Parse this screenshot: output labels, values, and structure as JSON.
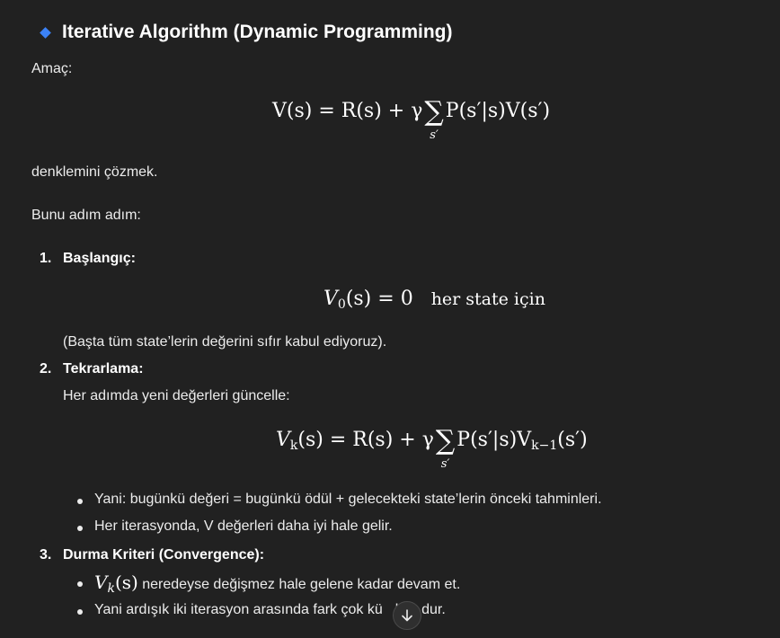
{
  "heading": {
    "icon": "blue-diamond-icon",
    "text": "Iterative Algorithm (Dynamic Programming)"
  },
  "intro": {
    "amac": "Amaç:",
    "eq1": {
      "lhs": "V(s) = R(s) + γ",
      "sum_index": "s′",
      "rhs": "P(s′|s)V(s′)"
    },
    "denklemini": "denklemini çözmek.",
    "bunu": "Bunu adım adım:"
  },
  "steps": [
    {
      "num": "1.",
      "title": "Başlangıç:",
      "eq": {
        "lhs": "V",
        "sub": "0",
        "rest": "(s) = 0",
        "text": "her state için"
      },
      "note": "(Başta tüm state’lerin değerini sıfır kabul ediyoruz)."
    },
    {
      "num": "2.",
      "title": "Tekrarlama:",
      "desc": "Her adımda yeni değerleri güncelle:",
      "eq": {
        "v": "V",
        "vsub": "k",
        "mid": "(s) = R(s) + γ",
        "sum_index": "s′",
        "p": "P(s′|s)V",
        "psub": "k−1",
        "end": "(s′)"
      },
      "bullets": [
        "Yani: bugünkü değeri = bugünkü ödül + gelecekteki state’lerin önceki tahminleri.",
        "Her iterasyonda, V değerleri daha iyi hale gelir."
      ]
    },
    {
      "num": "3.",
      "title": "Durma Kriteri (Convergence):",
      "bullets_math": {
        "v": "V",
        "sub": "k",
        "arg": "(s)",
        "text": " neredeyse değişmez hale gelene kadar devam et."
      },
      "bullet2_a": "Yani ardışık iki iterasyon arasında fark çok kü",
      "bullet2_b": "kse dur."
    }
  ],
  "scroll_button": {
    "icon": "arrow-down-icon"
  }
}
